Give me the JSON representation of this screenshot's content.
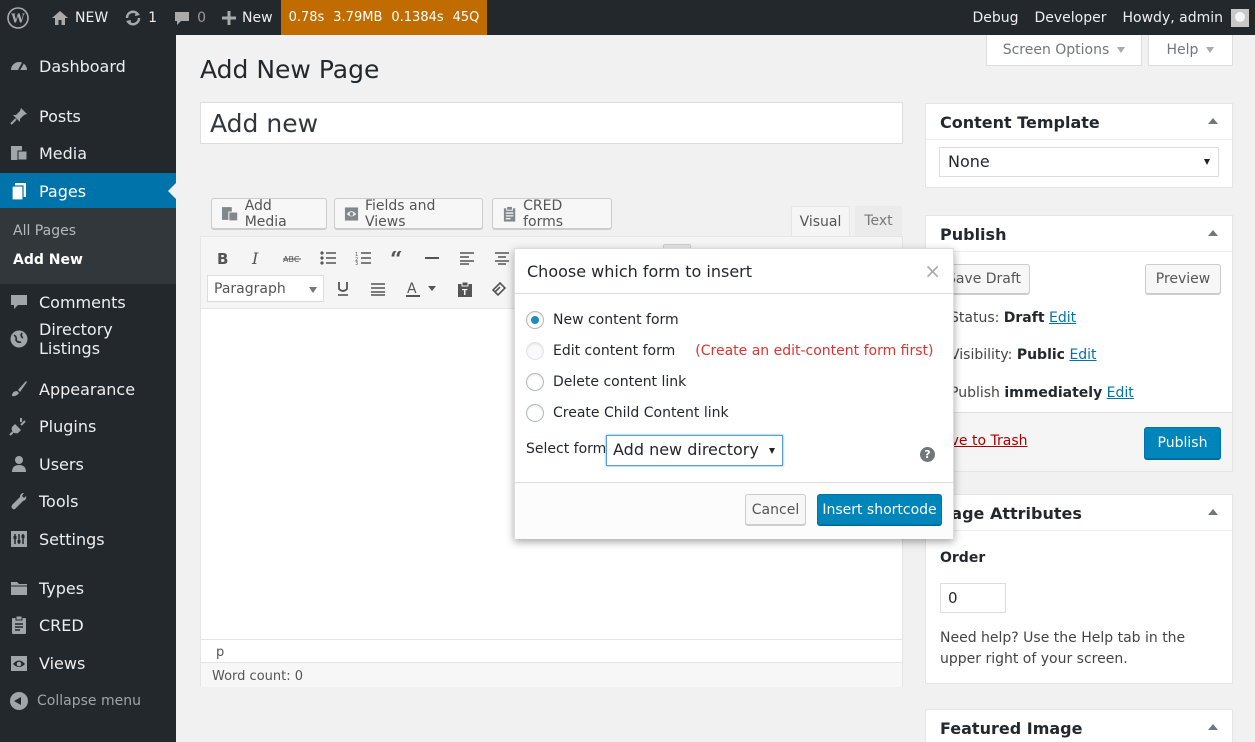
{
  "adminbar": {
    "site_name": "NEW",
    "updates": "1",
    "comments": "0",
    "new_label": "New",
    "perf": [
      "0.78s",
      "3.79MB",
      "0.1384s",
      "45Q"
    ],
    "debug": "Debug",
    "developer": "Developer",
    "howdy": "Howdy, admin"
  },
  "sidebar": {
    "items": [
      {
        "label": "Dashboard",
        "icon": "dashboard-icon"
      },
      {
        "label": "Posts",
        "icon": "pin-icon"
      },
      {
        "label": "Media",
        "icon": "media-icon"
      },
      {
        "label": "Pages",
        "icon": "pages-icon"
      },
      {
        "label": "Comments",
        "icon": "comment-icon"
      },
      {
        "label": "Directory Listings",
        "icon": "globe-icon"
      },
      {
        "label": "Appearance",
        "icon": "brush-icon"
      },
      {
        "label": "Plugins",
        "icon": "plugin-icon"
      },
      {
        "label": "Users",
        "icon": "user-icon"
      },
      {
        "label": "Tools",
        "icon": "wrench-icon"
      },
      {
        "label": "Settings",
        "icon": "settings-icon"
      },
      {
        "label": "Types",
        "icon": "folder-icon"
      },
      {
        "label": "CRED",
        "icon": "clipboard-icon"
      },
      {
        "label": "Views",
        "icon": "eye-icon"
      }
    ],
    "submenu": [
      "All Pages",
      "Add New"
    ],
    "collapse": "Collapse menu"
  },
  "screen_options": "Screen Options",
  "help": "Help",
  "page_title": "Add New Page",
  "title_value": "Add new",
  "media_buttons": [
    "Add Media",
    "Fields and Views",
    "CRED forms"
  ],
  "editor": {
    "tab_visual": "Visual",
    "tab_text": "Text",
    "format": "Paragraph",
    "path": "p",
    "word_count": "Word count: 0"
  },
  "content_template": {
    "title": "Content Template",
    "value": "None"
  },
  "publish": {
    "title": "Publish",
    "save_draft": "Save Draft",
    "preview": "Preview",
    "status_label": "Status:",
    "status_value": "Draft",
    "visibility_label": "Visibility:",
    "visibility_value": "Public",
    "publish_label": "Publish",
    "publish_value": "immediately",
    "edit": "Edit",
    "trash": "Move to Trash",
    "publish_btn": "Publish"
  },
  "page_attributes": {
    "title": "Page Attributes",
    "order_label": "Order",
    "order_value": "0",
    "help_text": "Need help? Use the Help tab in the upper right of your screen."
  },
  "featured_image": {
    "title": "Featured Image"
  },
  "modal": {
    "title": "Choose which form to insert",
    "close": "×",
    "options": [
      {
        "label": "New content form",
        "checked": true
      },
      {
        "label": "Edit content form",
        "checked": false,
        "note": "(Create an edit-content form first)"
      },
      {
        "label": "Delete content link",
        "checked": false
      },
      {
        "label": "Create Child Content link",
        "checked": false
      }
    ],
    "select_label": "Select form",
    "select_value": "Add new directory",
    "help": "?",
    "cancel": "Cancel",
    "insert": "Insert shortcode"
  },
  "colors": {
    "primary": "#0073aa",
    "adminbar": "#23282d",
    "perf": "#c06c00",
    "danger": "#a00"
  }
}
